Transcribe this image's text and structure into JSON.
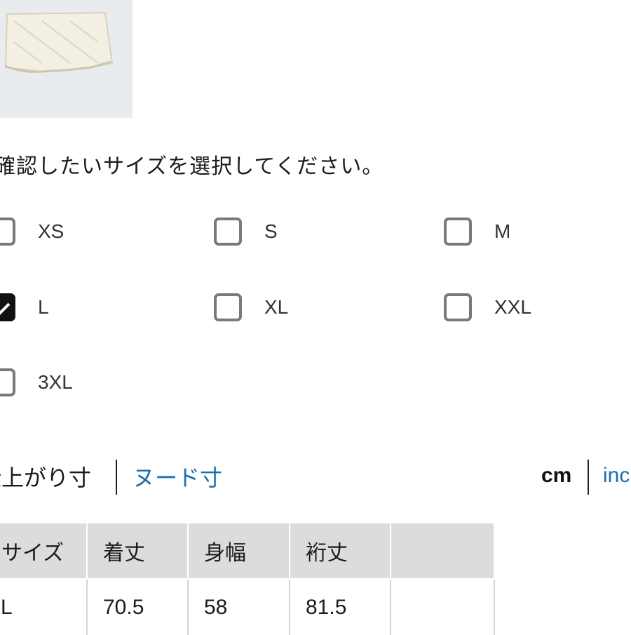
{
  "prompt": "確認したいサイズを選択してください。",
  "sizes": [
    {
      "label": "XS",
      "checked": false
    },
    {
      "label": "S",
      "checked": false
    },
    {
      "label": "M",
      "checked": false
    },
    {
      "label": "L",
      "checked": true
    },
    {
      "label": "XL",
      "checked": false
    },
    {
      "label": "XXL",
      "checked": false
    },
    {
      "label": "3XL",
      "checked": false
    }
  ],
  "measure_tabs": {
    "finished": "仕上がり寸",
    "body": "ヌード寸",
    "active_color": "#1a1a1a",
    "link_color": "#1a6fb0"
  },
  "units": {
    "cm": "cm",
    "inch": "inch"
  },
  "table": {
    "headers": [
      "サイズ",
      "着丈",
      "身幅",
      "裄丈",
      ""
    ],
    "rows": [
      [
        "L",
        "70.5",
        "58",
        "81.5",
        ""
      ]
    ]
  }
}
